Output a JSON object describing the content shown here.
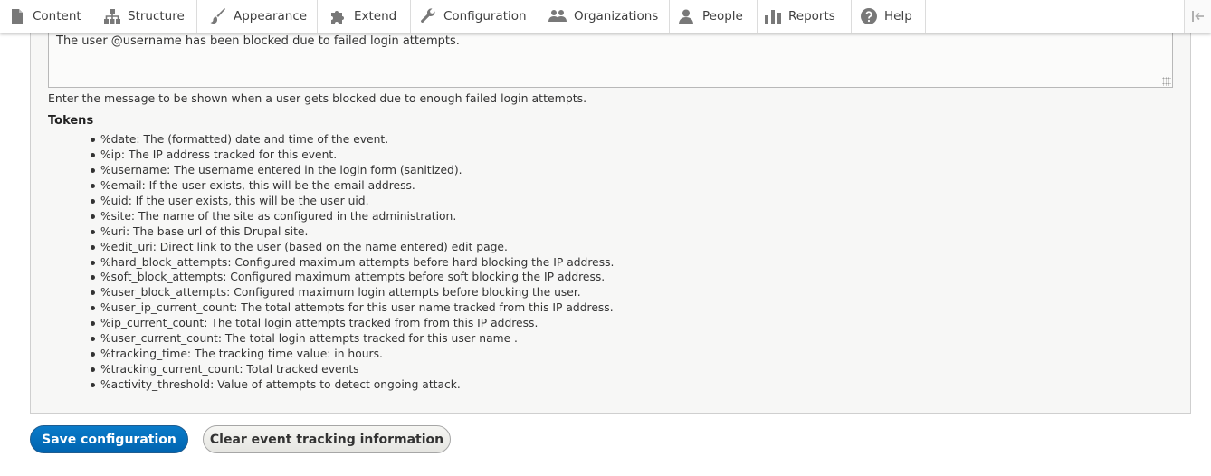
{
  "toolbar": {
    "items": [
      {
        "label": "Content",
        "icon": "page-icon"
      },
      {
        "label": "Structure",
        "icon": "sitemap-icon"
      },
      {
        "label": "Appearance",
        "icon": "paintbrush-icon"
      },
      {
        "label": "Extend",
        "icon": "puzzle-icon"
      },
      {
        "label": "Configuration",
        "icon": "wrench-icon"
      },
      {
        "label": "Organizations",
        "icon": "people-group-icon"
      },
      {
        "label": "People",
        "icon": "person-icon"
      },
      {
        "label": "Reports",
        "icon": "bar-chart-icon"
      },
      {
        "label": "Help",
        "icon": "question-circle-icon"
      }
    ],
    "toggle_icon": "collapse-arrow-icon"
  },
  "message": {
    "value": "The user @username has been blocked due to failed login attempts.",
    "description": "Enter the message to be shown when a user gets blocked due to enough failed login attempts."
  },
  "tokens": {
    "title": "Tokens",
    "items": [
      "%date: The (formatted) date and time of the event.",
      "%ip: The IP address tracked for this event.",
      "%username: The username entered in the login form (sanitized).",
      "%email: If the user exists, this will be the email address.",
      "%uid: If the user exists, this will be the user uid.",
      "%site: The name of the site as configured in the administration.",
      "%uri: The base url of this Drupal site.",
      "%edit_uri: Direct link to the user (based on the name entered) edit page.",
      "%hard_block_attempts: Configured maximum attempts before hard blocking the IP address.",
      "%soft_block_attempts: Configured maximum attempts before soft blocking the IP address.",
      "%user_block_attempts: Configured maximum login attempts before blocking the user.",
      "%user_ip_current_count: The total attempts for this user name tracked from this IP address.",
      "%ip_current_count: The total login attempts tracked from from this IP address.",
      "%user_current_count: The total login attempts tracked for this user name .",
      "%tracking_time: The tracking time value: in hours.",
      "%tracking_current_count: Total tracked events",
      "%activity_threshold: Value of attempts to detect ongoing attack."
    ]
  },
  "actions": {
    "save_label": "Save configuration",
    "clear_label": "Clear event tracking information"
  }
}
